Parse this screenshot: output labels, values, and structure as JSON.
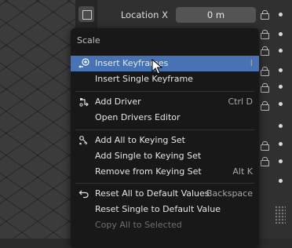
{
  "properties": {
    "location_x_label": "Location X",
    "location_x_value": "0 m"
  },
  "menu": {
    "title": "Scale",
    "items": [
      {
        "label": "Insert Keyframes",
        "shortcut": "I"
      },
      {
        "label": "Insert Single Keyframe",
        "shortcut": ""
      },
      {
        "label": "Add Driver",
        "shortcut": "Ctrl D"
      },
      {
        "label": "Open Drivers Editor",
        "shortcut": ""
      },
      {
        "label": "Add All to Keying Set",
        "shortcut": ""
      },
      {
        "label": "Add Single to Keying Set",
        "shortcut": ""
      },
      {
        "label": "Remove from Keying Set",
        "shortcut": "Alt K"
      },
      {
        "label": "Reset All to Default Values",
        "shortcut": "Backspace"
      },
      {
        "label": "Reset Single to Default Value",
        "shortcut": ""
      },
      {
        "label": "Copy All to Selected",
        "shortcut": ""
      }
    ]
  },
  "colors": {
    "highlight": "#4772b3",
    "menu_bg": "#181818",
    "field_bg": "#545454"
  }
}
